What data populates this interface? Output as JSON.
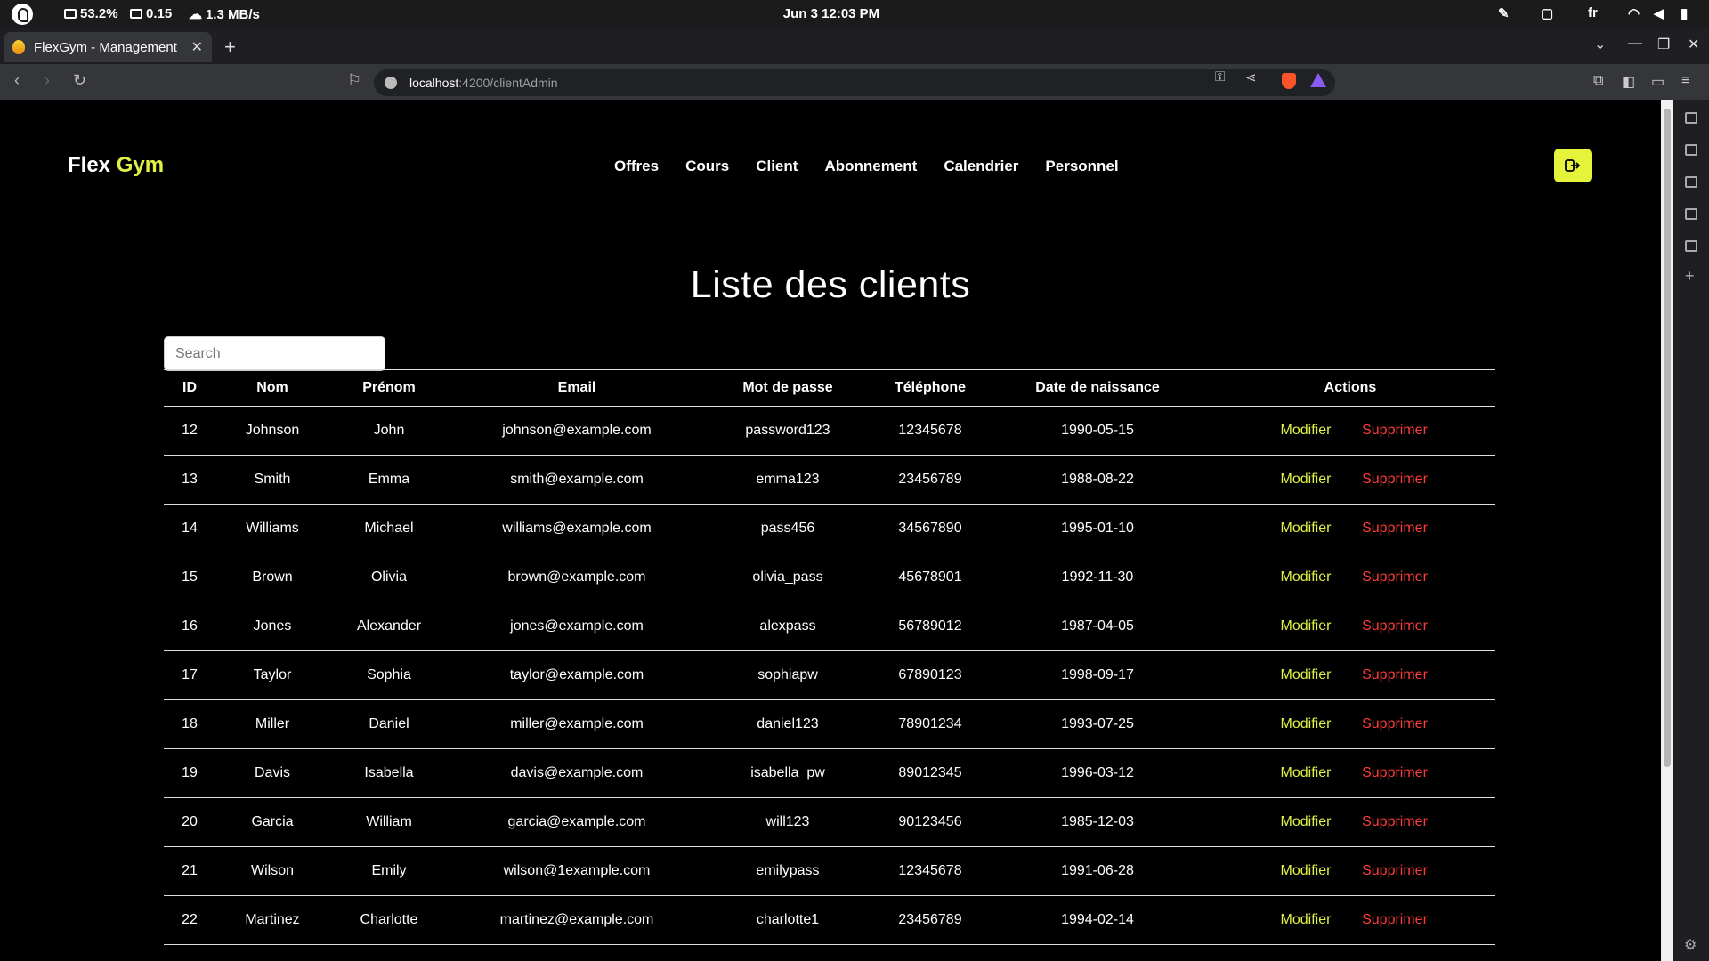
{
  "os": {
    "battery": "53.2%",
    "load": "0.15",
    "network": "1.3 MB/s",
    "datetime": "Jun 3  12:03 PM",
    "language": "fr"
  },
  "browser": {
    "tab_title": "FlexGym - Management",
    "url_host": "localhost",
    "url_path": ":4200/clientAdmin"
  },
  "site": {
    "brand_part1": "Flex",
    "brand_part2": "Gym",
    "brand_accent": "#dff046",
    "nav": [
      "Offres",
      "Cours",
      "Client",
      "Abonnement",
      "Calendrier",
      "Personnel"
    ],
    "logout_color": "#e5f33b"
  },
  "page": {
    "title": "Liste des clients",
    "search_placeholder": "Search"
  },
  "table": {
    "headers": [
      "ID",
      "Nom",
      "Prénom",
      "Email",
      "Mot de passe",
      "Téléphone",
      "Date de naissance",
      "Actions"
    ],
    "action_edit": "Modifier",
    "action_delete": "Supprimer",
    "edit_color": "#dff046",
    "delete_color": "#ff3b3b",
    "rows": [
      [
        "12",
        "Johnson",
        "John",
        "johnson@example.com",
        "password123",
        "12345678",
        "1990-05-15"
      ],
      [
        "13",
        "Smith",
        "Emma",
        "smith@example.com",
        "emma123",
        "23456789",
        "1988-08-22"
      ],
      [
        "14",
        "Williams",
        "Michael",
        "williams@example.com",
        "pass456",
        "34567890",
        "1995-01-10"
      ],
      [
        "15",
        "Brown",
        "Olivia",
        "brown@example.com",
        "olivia_pass",
        "45678901",
        "1992-11-30"
      ],
      [
        "16",
        "Jones",
        "Alexander",
        "jones@example.com",
        "alexpass",
        "56789012",
        "1987-04-05"
      ],
      [
        "17",
        "Taylor",
        "Sophia",
        "taylor@example.com",
        "sophiapw",
        "67890123",
        "1998-09-17"
      ],
      [
        "18",
        "Miller",
        "Daniel",
        "miller@example.com",
        "daniel123",
        "78901234",
        "1993-07-25"
      ],
      [
        "19",
        "Davis",
        "Isabella",
        "davis@example.com",
        "isabella_pw",
        "89012345",
        "1996-03-12"
      ],
      [
        "20",
        "Garcia",
        "William",
        "garcia@example.com",
        "will123",
        "90123456",
        "1985-12-03"
      ],
      [
        "21",
        "Wilson",
        "Emily",
        "wilson@1example.com",
        "emilypass",
        "12345678",
        "1991-06-28"
      ],
      [
        "22",
        "Martinez",
        "Charlotte",
        "martinez@example.com",
        "charlotte1",
        "23456789",
        "1994-02-14"
      ]
    ]
  }
}
